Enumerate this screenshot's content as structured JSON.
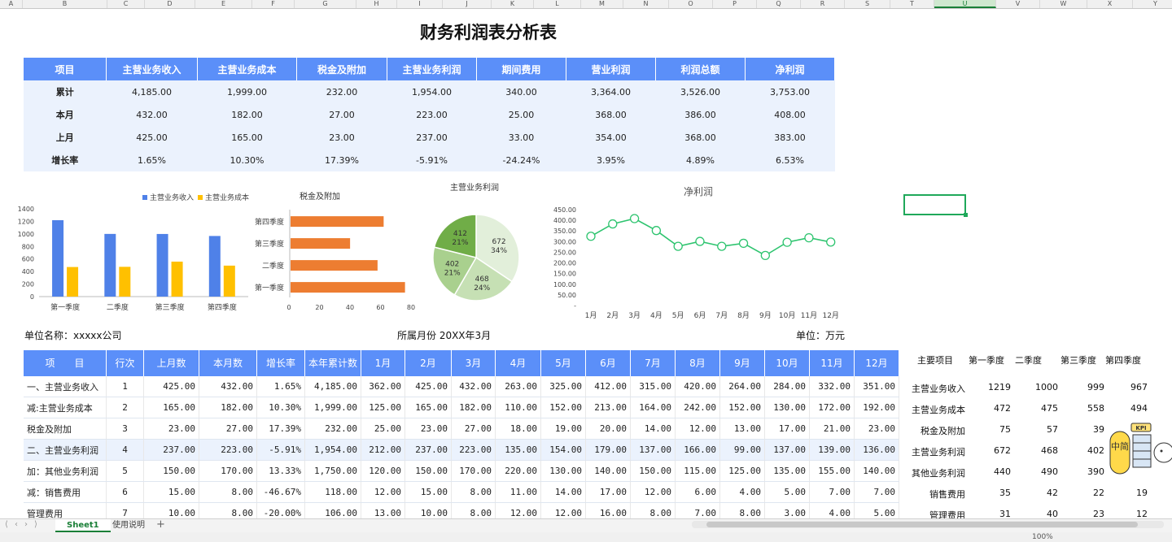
{
  "columns": [
    "A",
    "B",
    "C",
    "D",
    "E",
    "F",
    "G",
    "H",
    "I",
    "J",
    "K",
    "L",
    "M",
    "N",
    "O",
    "P",
    "Q",
    "R",
    "S",
    "T",
    "U",
    "V",
    "W",
    "X",
    "Y"
  ],
  "selected_column": "U",
  "title": "财务利润表分析表",
  "summary": {
    "headers": [
      "项目",
      "主营业务收入",
      "主营业务成本",
      "税金及附加",
      "主营业务利润",
      "期间费用",
      "营业利润",
      "利润总额",
      "净利润"
    ],
    "rows": [
      {
        "label": "累计",
        "values": [
          "4,185.00",
          "1,999.00",
          "232.00",
          "1,954.00",
          "340.00",
          "3,364.00",
          "3,526.00",
          "3,753.00"
        ]
      },
      {
        "label": "本月",
        "values": [
          "432.00",
          "182.00",
          "27.00",
          "223.00",
          "25.00",
          "368.00",
          "386.00",
          "408.00"
        ]
      },
      {
        "label": "上月",
        "values": [
          "425.00",
          "165.00",
          "23.00",
          "237.00",
          "33.00",
          "354.00",
          "368.00",
          "383.00"
        ]
      },
      {
        "label": "增长率",
        "values": [
          "1.65%",
          "10.30%",
          "17.39%",
          "-5.91%",
          "-24.24%",
          "3.95%",
          "4.89%",
          "6.53%"
        ]
      }
    ]
  },
  "chart_data": [
    {
      "type": "bar",
      "title": "",
      "categories": [
        "第一季度",
        "二季度",
        "第三季度",
        "第四季度"
      ],
      "series": [
        {
          "name": "主营业务收入",
          "values": [
            1219,
            1000,
            999,
            967
          ],
          "color": "#4f81e8"
        },
        {
          "name": "主营业务成本",
          "values": [
            472,
            475,
            558,
            494
          ],
          "color": "#ffc000"
        }
      ],
      "ylim": [
        0,
        1400
      ],
      "yticks": [
        0,
        200,
        400,
        600,
        800,
        1000,
        1200,
        1400
      ],
      "legend": "top"
    },
    {
      "type": "bar",
      "orientation": "horizontal",
      "title": "税金及附加",
      "categories": [
        "第四季度",
        "第三季度",
        "二季度",
        "第一季度"
      ],
      "values": [
        61,
        39,
        57,
        75
      ],
      "color": "#ed7d31",
      "xlim": [
        0,
        80
      ],
      "xticks": [
        0,
        20,
        40,
        60,
        80
      ]
    },
    {
      "type": "pie",
      "title": "主营业务利润",
      "values": [
        672,
        468,
        402,
        412
      ],
      "percent_labels": [
        "34%",
        "24%",
        "21%",
        "21%"
      ],
      "colors": [
        "#e2efda",
        "#c6e0b4",
        "#a9d08e",
        "#70ad47"
      ]
    },
    {
      "type": "line",
      "title": "净利润",
      "categories": [
        "1月",
        "2月",
        "3月",
        "4月",
        "5月",
        "6月",
        "7月",
        "8月",
        "9月",
        "10月",
        "11月",
        "12月"
      ],
      "values": [
        325,
        383,
        408,
        352,
        278,
        301,
        278,
        292,
        235,
        297,
        318,
        298
      ],
      "ylim": [
        0,
        450
      ],
      "yticks": [
        "-",
        "50.00",
        "100.00",
        "150.00",
        "200.00",
        "250.00",
        "300.00",
        "350.00",
        "400.00",
        "450.00"
      ],
      "color": "#2ec46f"
    }
  ],
  "meta": {
    "unit_name": "单位名称：xxxxx公司",
    "period": "所属月份 20XX年3月",
    "unit": "单位：万元"
  },
  "detail": {
    "headers": [
      "项　　目",
      "行次",
      "上月数",
      "本月数",
      "增长率",
      "本年累计数",
      "1月",
      "2月",
      "3月",
      "4月",
      "5月",
      "6月",
      "7月",
      "8月",
      "9月",
      "10月",
      "11月",
      "12月"
    ],
    "rows": [
      {
        "label": "一、主营业务收入",
        "no": "1",
        "values": [
          "425.00",
          "432.00",
          "1.65%",
          "4,185.00",
          "362.00",
          "425.00",
          "432.00",
          "263.00",
          "325.00",
          "412.00",
          "315.00",
          "420.00",
          "264.00",
          "284.00",
          "332.00",
          "351.00"
        ]
      },
      {
        "label": "减:主营业务成本",
        "no": "2",
        "values": [
          "165.00",
          "182.00",
          "10.30%",
          "1,999.00",
          "125.00",
          "165.00",
          "182.00",
          "110.00",
          "152.00",
          "213.00",
          "164.00",
          "242.00",
          "152.00",
          "130.00",
          "172.00",
          "192.00"
        ]
      },
      {
        "label": "税金及附加",
        "no": "3",
        "values": [
          "23.00",
          "27.00",
          "17.39%",
          "232.00",
          "25.00",
          "23.00",
          "27.00",
          "18.00",
          "19.00",
          "20.00",
          "14.00",
          "12.00",
          "13.00",
          "17.00",
          "21.00",
          "23.00"
        ]
      },
      {
        "label": "二、主营业务利润",
        "no": "4",
        "values": [
          "237.00",
          "223.00",
          "-5.91%",
          "1,954.00",
          "212.00",
          "237.00",
          "223.00",
          "135.00",
          "154.00",
          "179.00",
          "137.00",
          "166.00",
          "99.00",
          "137.00",
          "139.00",
          "136.00"
        ]
      },
      {
        "label": "加：其他业务利润",
        "no": "5",
        "values": [
          "150.00",
          "170.00",
          "13.33%",
          "1,750.00",
          "120.00",
          "150.00",
          "170.00",
          "220.00",
          "130.00",
          "140.00",
          "150.00",
          "115.00",
          "125.00",
          "135.00",
          "155.00",
          "140.00"
        ]
      },
      {
        "label": "减：销售费用",
        "no": "6",
        "values": [
          "15.00",
          "8.00",
          "-46.67%",
          "118.00",
          "12.00",
          "15.00",
          "8.00",
          "11.00",
          "14.00",
          "17.00",
          "12.00",
          "6.00",
          "4.00",
          "5.00",
          "7.00",
          "7.00"
        ]
      },
      {
        "label": "管理费用",
        "no": "7",
        "values": [
          "10.00",
          "8.00",
          "-20.00%",
          "106.00",
          "13.00",
          "10.00",
          "8.00",
          "12.00",
          "12.00",
          "16.00",
          "8.00",
          "7.00",
          "8.00",
          "3.00",
          "4.00",
          "5.00"
        ]
      }
    ]
  },
  "quarter": {
    "headers": [
      "主要项目",
      "第一季度",
      "二季度",
      "第三季度",
      "第四季度"
    ],
    "rows": [
      {
        "label": "主营业务收入",
        "values": [
          "1219",
          "1000",
          "999",
          "967"
        ]
      },
      {
        "label": "主营业务成本",
        "values": [
          "472",
          "475",
          "558",
          "494"
        ]
      },
      {
        "label": "税金及附加",
        "values": [
          "75",
          "57",
          "39",
          ""
        ]
      },
      {
        "label": "主营业务利润",
        "values": [
          "672",
          "468",
          "402",
          ""
        ]
      },
      {
        "label": "其他业务利润",
        "values": [
          "440",
          "490",
          "390",
          ""
        ]
      },
      {
        "label": "销售费用",
        "values": [
          "35",
          "42",
          "22",
          "19"
        ]
      },
      {
        "label": "管理费用",
        "values": [
          "31",
          "40",
          "23",
          "12"
        ]
      }
    ]
  },
  "mascot": {
    "badge": "KPI",
    "text": "中简"
  },
  "sheets": [
    {
      "name": "Sheet1",
      "active": true
    },
    {
      "name": "使用说明",
      "active": false
    }
  ],
  "add_sheet": "+",
  "zoom": "100%",
  "icons": [
    "first-sheet-icon",
    "prev-sheet-icon",
    "next-sheet-icon",
    "last-sheet-icon",
    "add-sheet-icon"
  ]
}
